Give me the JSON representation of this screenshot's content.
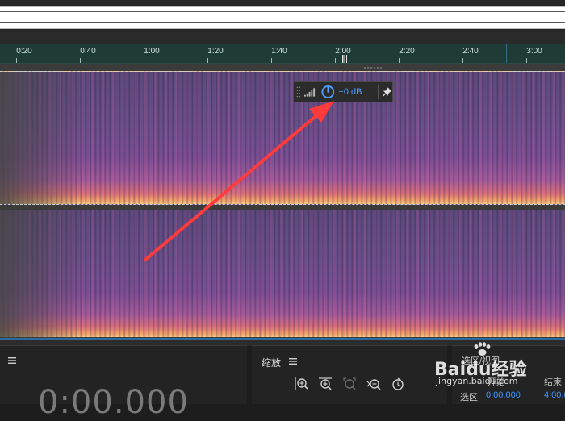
{
  "ruler": {
    "ticks": [
      "0:20",
      "0:40",
      "1:00",
      "1:20",
      "1:40",
      "2:00",
      "2:20",
      "2:40",
      "3:00"
    ]
  },
  "hud": {
    "gain": "+0 dB"
  },
  "zoom_panel": {
    "title": "缩放"
  },
  "transport": {
    "time": "0:00.000"
  },
  "selection_panel": {
    "title": "选区/视图",
    "col_start": "开始",
    "col_end": "结束",
    "row_selection": "选区",
    "selection_start": "0:00.000",
    "selection_end": "4:00.0"
  },
  "watermark": {
    "brand": "Baidu经验",
    "url": "jingyan.baidu.com"
  },
  "colors": {
    "accent": "#3d95ff",
    "ruler_bg": "#1f3b35",
    "arrow": "#ff3b3b"
  }
}
